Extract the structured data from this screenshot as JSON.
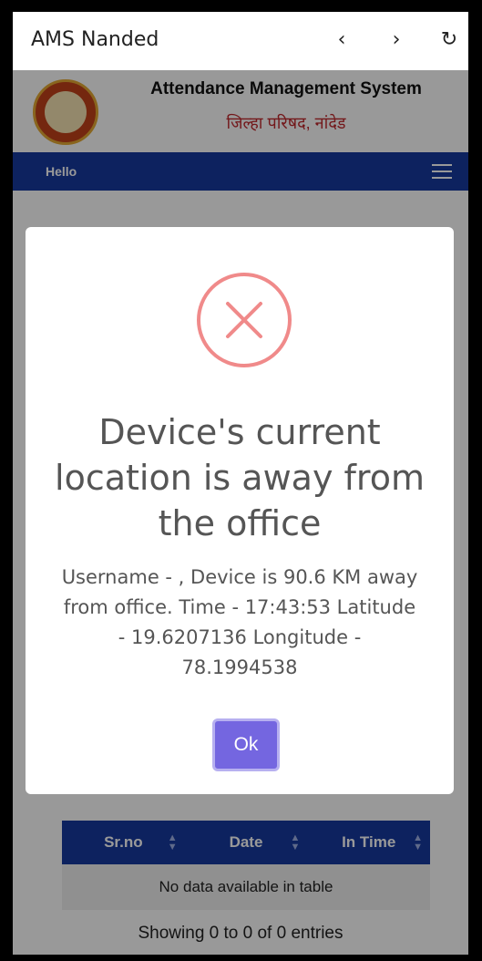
{
  "browser": {
    "title": "AMS Nanded",
    "back_icon": "‹",
    "forward_icon": "›",
    "reload_icon": "↻"
  },
  "header": {
    "title": "Attendance Management System",
    "subtitle": "जिल्हा परिषद, नांदेड"
  },
  "navbar": {
    "greeting": "Hello"
  },
  "table": {
    "columns": [
      "Sr.no",
      "Date",
      "In Time"
    ],
    "empty_message": "No data available in table",
    "info": "Showing 0 to 0 of 0 entries"
  },
  "modal": {
    "title": "Device's current location is away from the office",
    "message": "Username - , Device is 90.6 KM away from office. Time - 17:43:53 Latitude - 19.6207136 Longitude - 78.1994538",
    "ok_label": "Ok"
  },
  "colors": {
    "navbar": "#173a9e",
    "error": "#f08a8a",
    "ok_button": "#7466e0"
  }
}
